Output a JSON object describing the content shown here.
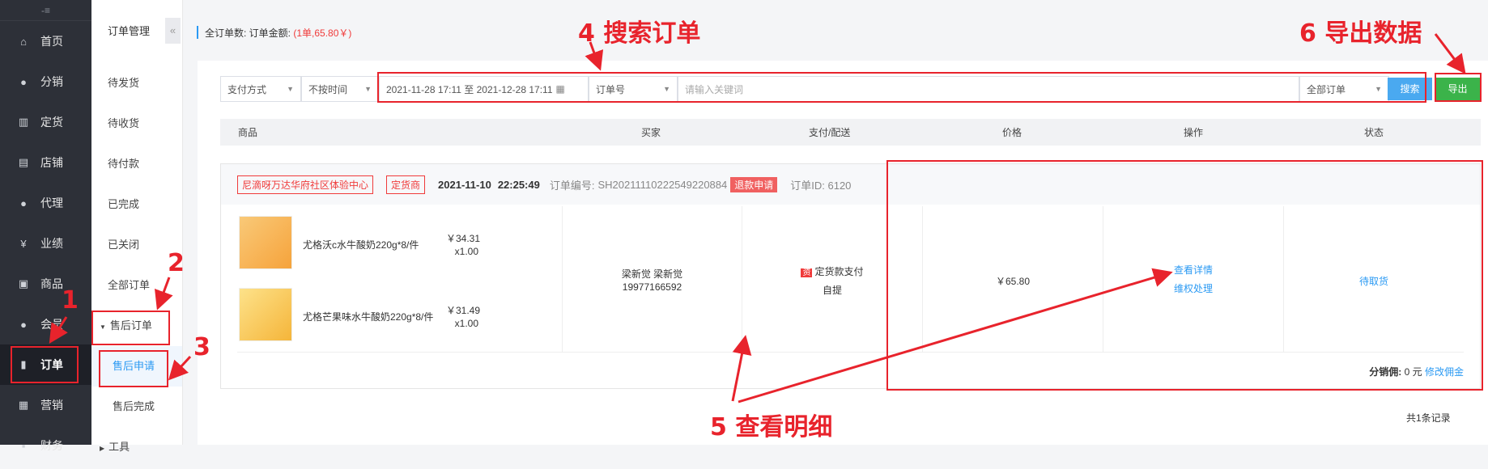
{
  "sidebar": {
    "top_icon": "-≡",
    "items": [
      {
        "label": "首页",
        "icon": "home-icon"
      },
      {
        "label": "分销",
        "icon": "user-icon"
      },
      {
        "label": "定货",
        "icon": "chart-icon"
      },
      {
        "label": "店铺",
        "icon": "store-icon"
      },
      {
        "label": "代理",
        "icon": "user-icon"
      },
      {
        "label": "业绩",
        "icon": "yen-icon"
      },
      {
        "label": "商品",
        "icon": "goods-icon"
      },
      {
        "label": "会员",
        "icon": "user-icon"
      },
      {
        "label": "订单",
        "icon": "file-icon"
      },
      {
        "label": "营销",
        "icon": "gift-icon"
      },
      {
        "label": "财务",
        "icon": "finance-icon"
      }
    ],
    "active": "订单"
  },
  "subnav": {
    "title": "订单管理",
    "items": [
      "待发货",
      "待收货",
      "待付款",
      "已完成",
      "已关闭",
      "全部订单"
    ],
    "aftersale": {
      "label": "售后订单",
      "children": [
        "售后申请",
        "售后完成"
      ]
    },
    "next": "工具"
  },
  "stats": {
    "label": "全订单数: 订单金额:",
    "value": "(1单,65.80￥)"
  },
  "filters": {
    "pay_method": "支付方式",
    "time": "不按时间",
    "date_range": "2021-11-28 17:11 至 2021-12-28 17:11",
    "order_field": "订单号",
    "keyword_placeholder": "请输入关键词",
    "order_type": "全部订单",
    "search": "搜索",
    "export": "导出"
  },
  "columns": [
    "商品",
    "买家",
    "支付/配送",
    "价格",
    "操作",
    "状态"
  ],
  "order": {
    "store": "尼滴呀万达华府社区体验中心",
    "type_tag": "定货商",
    "date": "2021-11-10",
    "time": "22:25:49",
    "order_no_label": "订单编号:",
    "order_no": "SH20211110222549220884",
    "refund_tag": "退款申请",
    "order_id": "订单ID: 6120",
    "items": [
      {
        "name": "尤格沃c水牛酸奶220g*8/件",
        "price": "￥34.31",
        "qty": "x1.00"
      },
      {
        "name": "尤格芒果味水牛酸奶220g*8/件",
        "price": "￥31.49",
        "qty": "x1.00"
      }
    ],
    "buyer_name": "梁新觉 梁新觉",
    "buyer_phone": "19977166592",
    "pay_icon": "资",
    "pay_method": "定货款支付",
    "delivery": "自提",
    "price": "￥65.80",
    "actions": [
      "查看详情",
      "维权处理"
    ],
    "status": "待取货",
    "commission_label": "分销佣:",
    "commission_value": "0 元",
    "commission_edit": "修改佣金"
  },
  "footer": {
    "total": "共1条记录"
  },
  "annotations": {
    "a1": "1",
    "a2": "2",
    "a3": "3",
    "a4": "4 搜索订单",
    "a5": "5 查看明细",
    "a6": "6 导出数据"
  },
  "colors": {
    "annotation": "#e8232c",
    "primary": "#2b9af3",
    "success": "#3bb34a",
    "sidebar": "#2d3038"
  }
}
